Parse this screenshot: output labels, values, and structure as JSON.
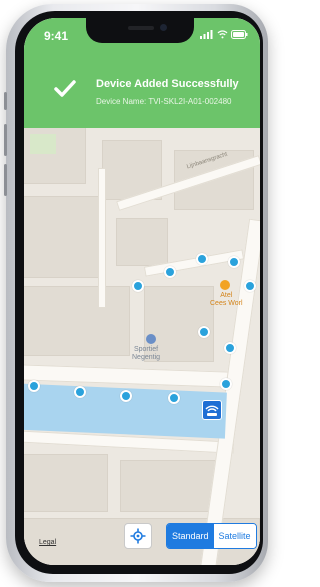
{
  "status_bar": {
    "time": "9:41"
  },
  "notification": {
    "title": "Device Added Successfully",
    "subtitle": "Device Name: TVI-SKL2I-A01-002480"
  },
  "map": {
    "street_label": "Lijnbaansgracht",
    "poi_cafe": "Atel\nCees Worl",
    "poi_sport": "Sportief\nNegentig"
  },
  "controls": {
    "legal": "Legal",
    "standard_label": "Standard",
    "satellite_label": "Satellite",
    "selected_map_type": "Standard"
  },
  "colors": {
    "banner": "#6cc46a",
    "route_dot": "#2aa2dc",
    "accent": "#1f7be0"
  },
  "icons": {
    "check": "check-icon",
    "locate": "locate-icon",
    "device": "device-icon",
    "signal": "signal-icon",
    "wifi": "wifi-icon",
    "battery": "battery-icon"
  }
}
